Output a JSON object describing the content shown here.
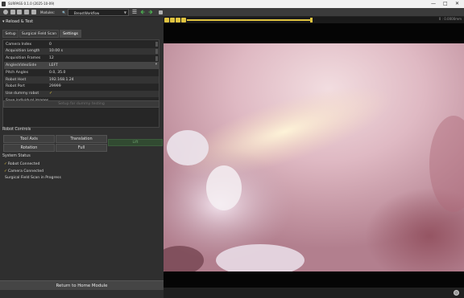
{
  "window": {
    "title": "SURPASS 0.1.0 (2025-10-09)",
    "controls": [
      "—",
      "□",
      "✕"
    ]
  },
  "toolbar": {
    "modules_label": "Modules:",
    "module_selected": "BreastWorkflow",
    "accent": "#e0c440"
  },
  "panel": {
    "reload_label": "Reload & Test",
    "tabs": [
      "Setup",
      "Surgical Field Scan",
      "Settings"
    ],
    "active_tab": "Settings",
    "fields": [
      {
        "label": "Camera Index",
        "value": "0"
      },
      {
        "label": "Acquisition Length",
        "value": "10.00 s"
      },
      {
        "label": "Acquisition Frames",
        "value": "12"
      },
      {
        "label": "AnglesVideoSide",
        "value": "LEFT"
      },
      {
        "label": "Pitch Angles",
        "value": "0.0, 35.0"
      },
      {
        "label": "Robot Host",
        "value": "192.168.1.24"
      },
      {
        "label": "Robot Port",
        "value": "29999"
      },
      {
        "label": "Use dummy robot",
        "value": "✓"
      },
      {
        "label": "Save individual images",
        "value": ""
      }
    ],
    "setup_button": "Setup for dummy testing",
    "robot_controls": {
      "heading": "Robot Controls",
      "tool_axis": "Tool Axis",
      "translation": "Translation",
      "rotation": "Rotation",
      "full": "Full",
      "lift": "Lift"
    },
    "system_status": {
      "heading": "System Status",
      "items": [
        {
          "check": "✓",
          "text": "Robot Connected"
        },
        {
          "check": "✓",
          "text": "Camera Connected"
        },
        {
          "check": "",
          "text": "Surgical Field Scan in Progress"
        }
      ]
    },
    "home_button": "Return to Home Module"
  },
  "viewer": {
    "zoom_readout": "0 : 0.0000mm",
    "slider_fraction": 0.96
  }
}
